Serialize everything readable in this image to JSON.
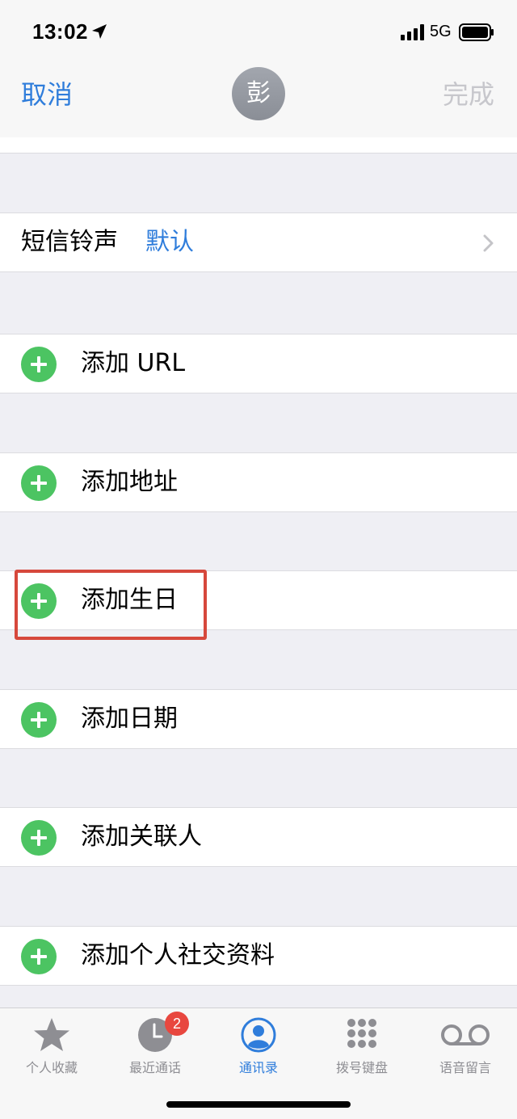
{
  "status": {
    "time": "13:02",
    "network": "5G"
  },
  "nav": {
    "cancel": "取消",
    "avatar_initial": "彭",
    "done": "完成"
  },
  "text_tone": {
    "label": "短信铃声",
    "value": "默认"
  },
  "add_rows": [
    "添加 URL",
    "添加地址",
    "添加生日",
    "添加日期",
    "添加关联人",
    "添加个人社交资料"
  ],
  "tabs": [
    {
      "label": "个人收藏",
      "icon": "star-icon"
    },
    {
      "label": "最近通话",
      "icon": "clock-icon",
      "badge": "2"
    },
    {
      "label": "通讯录",
      "icon": "contacts-icon",
      "active": true
    },
    {
      "label": "拨号键盘",
      "icon": "keypad-icon"
    },
    {
      "label": "语音留言",
      "icon": "voicemail-icon"
    }
  ],
  "colors": {
    "accent": "#2f7ddb",
    "add_green": "#4cc462",
    "highlight": "#d6483c",
    "badge": "#e8473f"
  }
}
